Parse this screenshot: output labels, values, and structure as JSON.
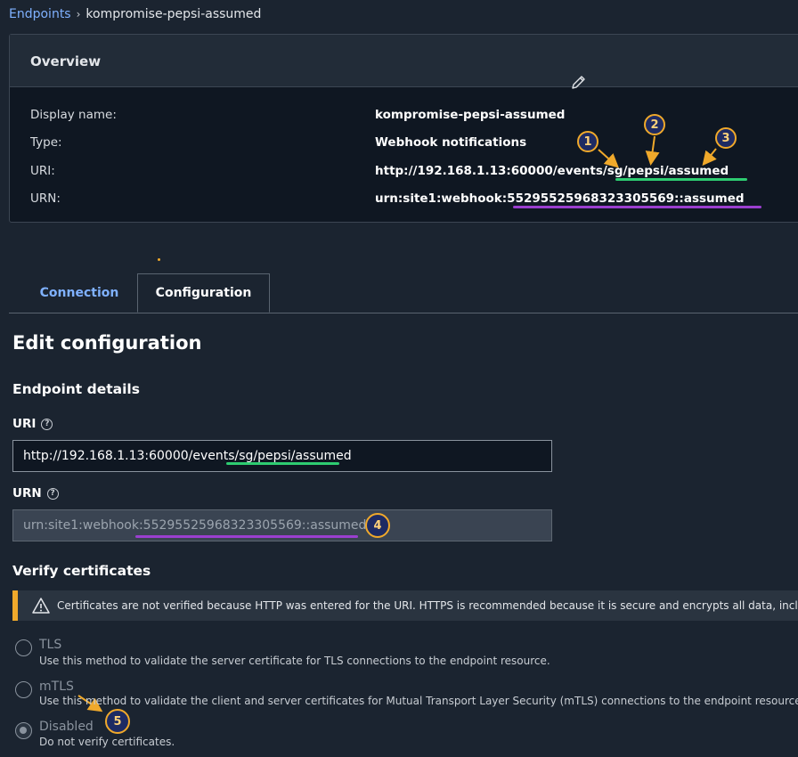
{
  "breadcrumb": {
    "parent": "Endpoints",
    "separator": "›",
    "current": "kompromise-pepsi-assumed"
  },
  "overview": {
    "title": "Overview",
    "rows": [
      {
        "label": "Display name:",
        "value": "kompromise-pepsi-assumed"
      },
      {
        "label": "Type:",
        "value": "Webhook notifications"
      },
      {
        "label": "URI:",
        "value": "http://192.168.1.13:60000/events/sg/pepsi/assumed"
      },
      {
        "label": "URN:",
        "value": "urn:site1:webhook:55295525968323305569::assumed"
      }
    ]
  },
  "annotations": [
    "1",
    "2",
    "3",
    "4",
    "5"
  ],
  "tabs": [
    {
      "label": "Connection",
      "active": false
    },
    {
      "label": "Configuration",
      "active": true
    }
  ],
  "form": {
    "heading": "Edit configuration",
    "section": "Endpoint details",
    "uri_label": "URI",
    "uri_value": "http://192.168.1.13:60000/events/sg/pepsi/assumed",
    "urn_label": "URN",
    "urn_value": "urn:site1:webhook:55295525968323305569::assumed",
    "help_glyph": "?"
  },
  "certificates": {
    "heading": "Verify certificates",
    "alert": "Certificates are not verified because HTTP was entered for the URI. HTTPS is recommended because it is secure and encrypts all data, including",
    "options": [
      {
        "title": "TLS",
        "desc": "Use this method to validate the server certificate for TLS connections to the endpoint resource.",
        "selected": false
      },
      {
        "title": "mTLS",
        "desc": "Use this method to validate the client and server certificates for Mutual Transport Layer Security (mTLS) connections to the endpoint resource.",
        "selected": false
      },
      {
        "title": "Disabled",
        "desc": "Do not verify certificates.",
        "selected": true
      }
    ]
  },
  "colors": {
    "accent": "#7fb1ff",
    "warning": "#f0a92b",
    "green_underline": "#2ecc71",
    "purple_underline": "#9b3fd0"
  }
}
